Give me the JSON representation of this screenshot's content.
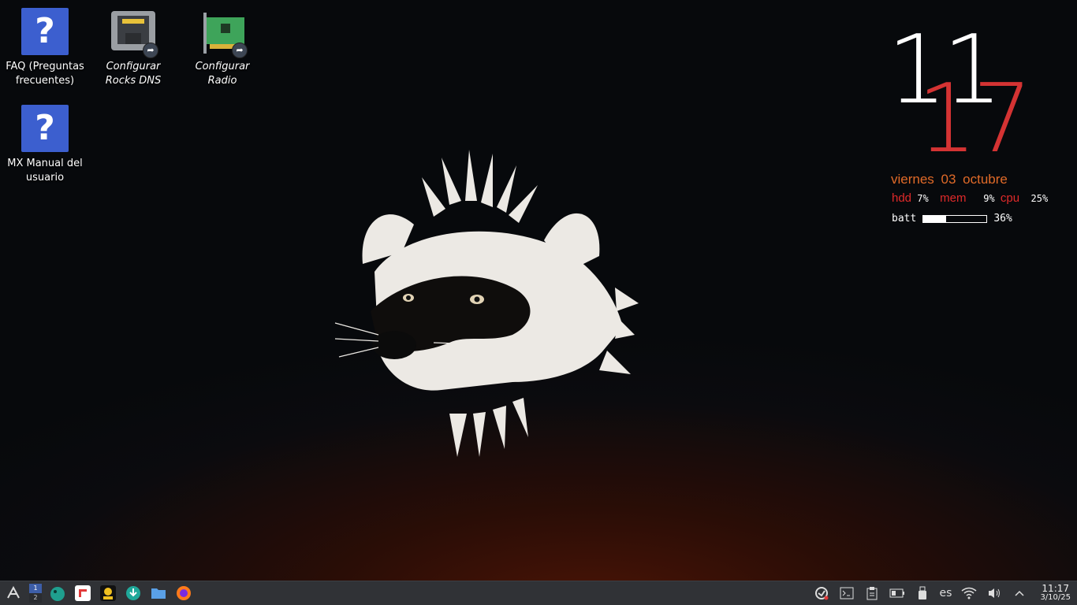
{
  "desktop": {
    "icons": [
      {
        "label": "FAQ (Preguntas frecuentes)",
        "icon": "question-icon"
      },
      {
        "label": "Configurar Rocks DNS",
        "icon": "network-card-icon"
      },
      {
        "label": "Configurar Radio",
        "icon": "pci-card-icon"
      },
      {
        "label": "MX Manual del usuario",
        "icon": "question-icon"
      }
    ]
  },
  "conky": {
    "hours": "11",
    "minutes": "17",
    "date": "viernes  03 octubre",
    "stats": {
      "hdd_label": "hdd",
      "hdd_value": "7%",
      "mem_label": "mem",
      "mem_value": "9%",
      "cpu_label": "cpu",
      "cpu_value": "25%"
    },
    "battery": {
      "label": "batt",
      "value": "36%",
      "level": 0.36
    },
    "colors": {
      "hours": "#ffffff",
      "minutes": "#d43333",
      "date": "#e06a28",
      "stat_label": "#e02a2a"
    }
  },
  "taskbar": {
    "launchers": [
      "mx-tools-icon",
      "workspace-pager",
      "mx-package-icon",
      "flatpak-icon",
      "bulk-renamer-icon",
      "mx-installer-icon",
      "file-manager-icon",
      "firefox-icon"
    ],
    "pager": {
      "ws1": "1",
      "ws2": "2"
    },
    "tray": [
      "updater-icon",
      "terminal-icon",
      "clipboard-icon",
      "battery-icon",
      "usb-icon",
      "wifi-icon",
      "volume-icon",
      "expand-tray-icon"
    ],
    "language": "es",
    "clock_time": "11:17",
    "clock_date": "3/10/25"
  }
}
